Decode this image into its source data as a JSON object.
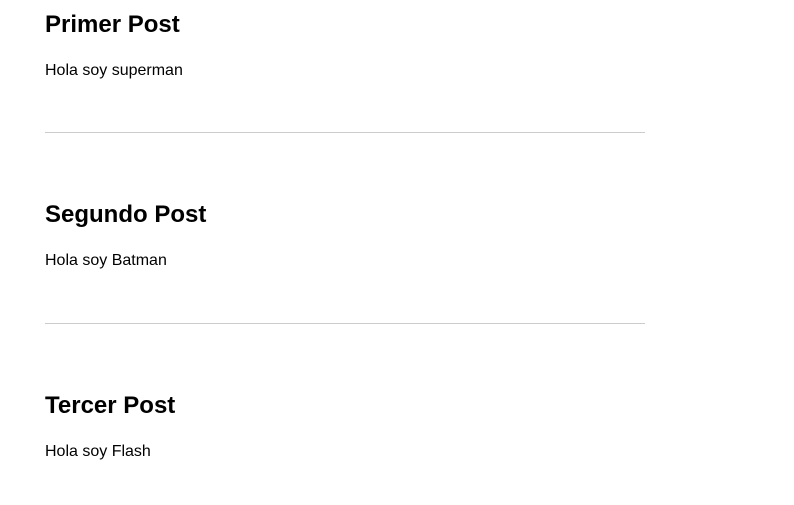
{
  "posts": [
    {
      "title": "Primer Post",
      "body": "Hola soy superman"
    },
    {
      "title": "Segundo Post",
      "body": "Hola soy Batman"
    },
    {
      "title": "Tercer Post",
      "body": "Hola soy Flash"
    }
  ],
  "colors": {
    "text": "#000000",
    "divider": "#cccccc",
    "background": "#ffffff"
  }
}
